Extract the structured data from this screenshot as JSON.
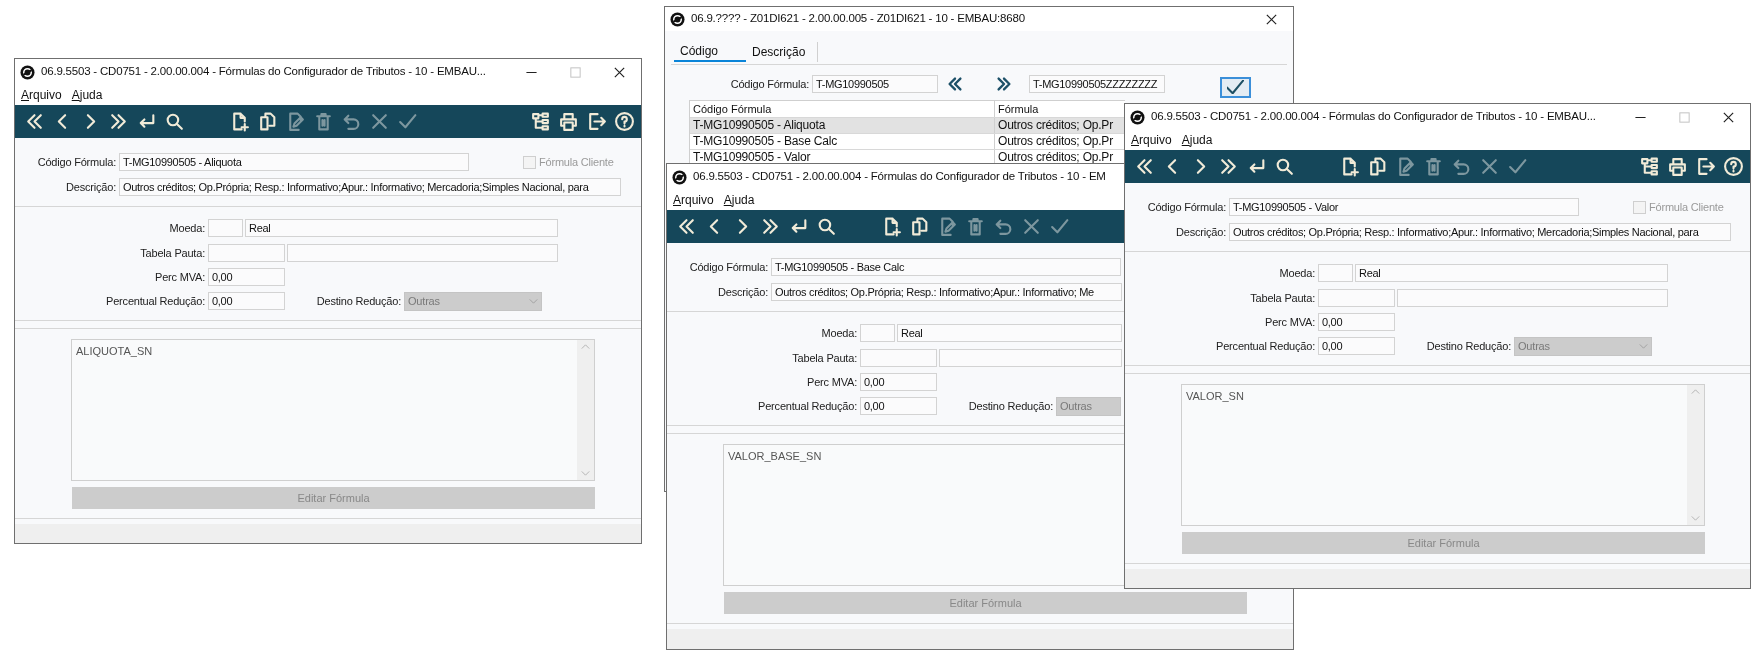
{
  "windows": [
    {
      "kind": "formula",
      "title": "06.9.5503 - CD0751 - 2.00.00.004 - Fórmulas do Configurador de Tributos - 10 - EMBAU...",
      "window_buttons": [
        {
          "kind": "minimize",
          "disabled": false
        },
        {
          "kind": "maximize",
          "disabled": true
        },
        {
          "kind": "close",
          "disabled": false
        }
      ],
      "menu": [
        "Arquivo",
        "Ajuda"
      ],
      "toolbar": {
        "navigation": [
          {
            "kind": "first",
            "disabled": false
          },
          {
            "kind": "previous",
            "disabled": false
          },
          {
            "kind": "next",
            "disabled": false
          },
          {
            "kind": "last",
            "disabled": false
          },
          {
            "kind": "goto",
            "disabled": false
          },
          {
            "kind": "search",
            "disabled": false
          }
        ],
        "edit": [
          {
            "kind": "new",
            "disabled": false
          },
          {
            "kind": "copy",
            "disabled": false
          },
          {
            "kind": "edit",
            "disabled": true
          },
          {
            "kind": "delete",
            "disabled": true
          },
          {
            "kind": "undo",
            "disabled": true
          },
          {
            "kind": "cancel",
            "disabled": true
          },
          {
            "kind": "save",
            "disabled": true
          }
        ],
        "utility": [
          {
            "kind": "structure",
            "disabled": false
          },
          {
            "kind": "print",
            "disabled": false
          },
          {
            "kind": "exit",
            "disabled": false
          },
          {
            "kind": "help",
            "disabled": false
          }
        ]
      },
      "codigo": {
        "label": "Código Fórmula:",
        "value": "T-MG10990505 - Aliquota"
      },
      "formula_cliente": {
        "label": "Fórmula Cliente",
        "checked": false,
        "disabled": true
      },
      "descricao": {
        "label": "Descrição:",
        "value": "Outros créditos; Op.Própria; Resp.: Informativo;Apur.: Informativo; Mercadoria;Simples Nacional, para"
      },
      "moeda": {
        "label": "Moeda:",
        "value": "Real"
      },
      "tabela_pauta": {
        "label": "Tabela Pauta:"
      },
      "perc_mva": {
        "label": "Perc MVA:",
        "value": "0,00"
      },
      "percentual_reducao": {
        "label": "Percentual Redução:",
        "value": "0,00"
      },
      "destino_reducao": {
        "label": "Destino Redução:",
        "value": "Outras",
        "disabled": true
      },
      "formula_text": "ALIQUOTA_SN",
      "edit_button": {
        "label": "Editar Fórmula",
        "disabled": true
      }
    },
    {
      "kind": "search",
      "title": "06.9.???? - Z01DI621 - 2.00.00.005 - Z01DI621 - 10 - EMBAU:8680",
      "window_buttons": [
        {
          "kind": "close",
          "disabled": false
        }
      ],
      "tabs": [
        {
          "label": "Código",
          "selected": true
        },
        {
          "label": "Descrição",
          "selected": false
        }
      ],
      "filter": {
        "label": "Código Fórmula:",
        "from": "T-MG10990505",
        "to": "T-MG10990505ZZZZZZZZ"
      },
      "table": {
        "columns": [
          "Código Fórmula",
          "Fórmula"
        ],
        "rows": [
          {
            "cells": [
              "T-MG10990505 - Aliquota",
              "Outros créditos; Op.Pr"
            ],
            "selected": true
          },
          {
            "cells": [
              "T-MG10990505 - Base Calc",
              "Outros créditos; Op.Pr"
            ],
            "selected": false
          },
          {
            "cells": [
              "T-MG10990505 - Valor",
              "Outros créditos; Op.Pr"
            ],
            "selected": false
          }
        ]
      }
    },
    {
      "kind": "formula",
      "title": "06.9.5503 - CD0751 - 2.00.00.004 - Fórmulas do Configurador de Tributos - 10 - EM",
      "menu": [
        "Arquivo",
        "Ajuda"
      ],
      "toolbar": {
        "navigation": [
          {
            "kind": "first",
            "disabled": false
          },
          {
            "kind": "previous",
            "disabled": false
          },
          {
            "kind": "next",
            "disabled": false
          },
          {
            "kind": "last",
            "disabled": false
          },
          {
            "kind": "goto",
            "disabled": false
          },
          {
            "kind": "search",
            "disabled": false
          }
        ],
        "edit": [
          {
            "kind": "new",
            "disabled": false
          },
          {
            "kind": "copy",
            "disabled": false
          },
          {
            "kind": "edit",
            "disabled": true
          },
          {
            "kind": "delete",
            "disabled": true
          },
          {
            "kind": "undo",
            "disabled": true
          },
          {
            "kind": "cancel",
            "disabled": true
          },
          {
            "kind": "save",
            "disabled": true
          }
        ]
      },
      "codigo": {
        "label": "Código Fórmula:",
        "value": "T-MG10990505 - Base Calc"
      },
      "descricao": {
        "label": "Descrição:",
        "value": "Outros créditos; Op.Própria; Resp.: Informativo;Apur.: Informativo; Me"
      },
      "moeda": {
        "label": "Moeda:",
        "value": "Real"
      },
      "tabela_pauta": {
        "label": "Tabela Pauta:"
      },
      "perc_mva": {
        "label": "Perc MVA:",
        "value": "0,00"
      },
      "percentual_reducao": {
        "label": "Percentual Redução:",
        "value": "0,00"
      },
      "destino_reducao": {
        "label": "Destino Redução:",
        "value": "Outras",
        "disabled": true
      },
      "formula_text": "VALOR_BASE_SN",
      "edit_button": {
        "label": "Editar Fórmula",
        "disabled": true
      }
    },
    {
      "kind": "formula",
      "title": "06.9.5503 - CD0751 - 2.00.00.004 - Fórmulas do Configurador de Tributos - 10 - EMBAU...",
      "window_buttons": [
        {
          "kind": "minimize",
          "disabled": false
        },
        {
          "kind": "maximize",
          "disabled": true
        },
        {
          "kind": "close",
          "disabled": false
        }
      ],
      "menu": [
        "Arquivo",
        "Ajuda"
      ],
      "toolbar": {
        "navigation": [
          {
            "kind": "first",
            "disabled": false
          },
          {
            "kind": "previous",
            "disabled": false
          },
          {
            "kind": "next",
            "disabled": false
          },
          {
            "kind": "last",
            "disabled": false
          },
          {
            "kind": "goto",
            "disabled": false
          },
          {
            "kind": "search",
            "disabled": false
          }
        ],
        "edit": [
          {
            "kind": "new",
            "disabled": false
          },
          {
            "kind": "copy",
            "disabled": false
          },
          {
            "kind": "edit",
            "disabled": true
          },
          {
            "kind": "delete",
            "disabled": true
          },
          {
            "kind": "undo",
            "disabled": true
          },
          {
            "kind": "cancel",
            "disabled": true
          },
          {
            "kind": "save",
            "disabled": true
          }
        ],
        "utility": [
          {
            "kind": "structure",
            "disabled": false
          },
          {
            "kind": "print",
            "disabled": false
          },
          {
            "kind": "exit",
            "disabled": false
          },
          {
            "kind": "help",
            "disabled": false
          }
        ]
      },
      "codigo": {
        "label": "Código Fórmula:",
        "value": "T-MG10990505 - Valor"
      },
      "formula_cliente": {
        "label": "Fórmula Cliente",
        "checked": false,
        "disabled": true
      },
      "descricao": {
        "label": "Descrição:",
        "value": "Outros créditos; Op.Própria; Resp.: Informativo;Apur.: Informativo; Mercadoria;Simples Nacional, para"
      },
      "moeda": {
        "label": "Moeda:",
        "value": "Real"
      },
      "tabela_pauta": {
        "label": "Tabela Pauta:"
      },
      "perc_mva": {
        "label": "Perc MVA:",
        "value": "0,00"
      },
      "percentual_reducao": {
        "label": "Percentual Redução:",
        "value": "0,00"
      },
      "destino_reducao": {
        "label": "Destino Redução:",
        "value": "Outras",
        "disabled": true
      },
      "formula_text": "VALOR_SN",
      "edit_button": {
        "label": "Editar Fórmula",
        "disabled": true
      }
    }
  ]
}
